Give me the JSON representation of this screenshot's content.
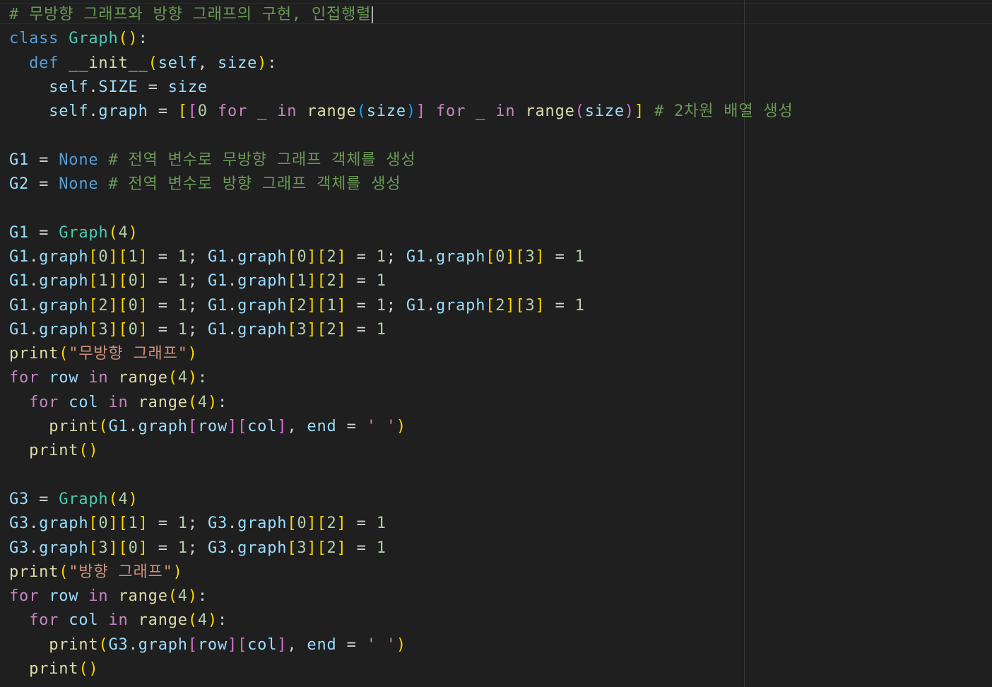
{
  "editor": {
    "lines": [
      [
        [
          "comment",
          "# 무방향 그래프와 방향 그래프의 구현, 인접행렬"
        ]
      ],
      [
        [
          "kw-blue",
          "class"
        ],
        [
          "plain",
          " "
        ],
        [
          "cls",
          "Graph"
        ],
        [
          "b1",
          "()"
        ],
        [
          "plain",
          ":"
        ]
      ],
      [
        [
          "plain",
          "  "
        ],
        [
          "kw-blue",
          "def"
        ],
        [
          "plain",
          " "
        ],
        [
          "func",
          "__init__"
        ],
        [
          "b1",
          "("
        ],
        [
          "var",
          "self"
        ],
        [
          "plain",
          ", "
        ],
        [
          "var",
          "size"
        ],
        [
          "b1",
          ")"
        ],
        [
          "plain",
          ":"
        ]
      ],
      [
        [
          "plain",
          "    "
        ],
        [
          "var",
          "self"
        ],
        [
          "plain",
          "."
        ],
        [
          "var",
          "SIZE"
        ],
        [
          "plain",
          " = "
        ],
        [
          "var",
          "size"
        ]
      ],
      [
        [
          "plain",
          "    "
        ],
        [
          "var",
          "self"
        ],
        [
          "plain",
          "."
        ],
        [
          "var",
          "graph"
        ],
        [
          "plain",
          " = "
        ],
        [
          "b1",
          "["
        ],
        [
          "b2",
          "["
        ],
        [
          "num",
          "0"
        ],
        [
          "plain",
          " "
        ],
        [
          "kw-ctrl",
          "for"
        ],
        [
          "plain",
          " "
        ],
        [
          "var",
          "_"
        ],
        [
          "plain",
          " "
        ],
        [
          "kw-ctrl",
          "in"
        ],
        [
          "plain",
          " "
        ],
        [
          "func",
          "range"
        ],
        [
          "b3",
          "("
        ],
        [
          "var",
          "size"
        ],
        [
          "b3",
          ")"
        ],
        [
          "b2",
          "]"
        ],
        [
          "plain",
          " "
        ],
        [
          "kw-ctrl",
          "for"
        ],
        [
          "plain",
          " "
        ],
        [
          "var",
          "_"
        ],
        [
          "plain",
          " "
        ],
        [
          "kw-ctrl",
          "in"
        ],
        [
          "plain",
          " "
        ],
        [
          "func",
          "range"
        ],
        [
          "b2",
          "("
        ],
        [
          "var",
          "size"
        ],
        [
          "b2",
          ")"
        ],
        [
          "b1",
          "]"
        ],
        [
          "plain",
          " "
        ],
        [
          "comment",
          "# 2차원 배열 생성"
        ]
      ],
      [
        [
          "plain",
          ""
        ]
      ],
      [
        [
          "var",
          "G1"
        ],
        [
          "plain",
          " = "
        ],
        [
          "kw-blue",
          "None"
        ],
        [
          "plain",
          " "
        ],
        [
          "comment",
          "# 전역 변수로 무방향 그래프 객체를 생성"
        ]
      ],
      [
        [
          "var",
          "G2"
        ],
        [
          "plain",
          " = "
        ],
        [
          "kw-blue",
          "None"
        ],
        [
          "plain",
          " "
        ],
        [
          "comment",
          "# 전역 변수로 방향 그래프 객체를 생성"
        ]
      ],
      [
        [
          "plain",
          ""
        ]
      ],
      [
        [
          "var",
          "G1"
        ],
        [
          "plain",
          " = "
        ],
        [
          "cls",
          "Graph"
        ],
        [
          "b1",
          "("
        ],
        [
          "num",
          "4"
        ],
        [
          "b1",
          ")"
        ]
      ],
      [
        [
          "var",
          "G1"
        ],
        [
          "plain",
          "."
        ],
        [
          "var",
          "graph"
        ],
        [
          "b1",
          "["
        ],
        [
          "num",
          "0"
        ],
        [
          "b1",
          "]"
        ],
        [
          "b1",
          "["
        ],
        [
          "num",
          "1"
        ],
        [
          "b1",
          "]"
        ],
        [
          "plain",
          " = "
        ],
        [
          "num",
          "1"
        ],
        [
          "plain",
          "; "
        ],
        [
          "var",
          "G1"
        ],
        [
          "plain",
          "."
        ],
        [
          "var",
          "graph"
        ],
        [
          "b1",
          "["
        ],
        [
          "num",
          "0"
        ],
        [
          "b1",
          "]"
        ],
        [
          "b1",
          "["
        ],
        [
          "num",
          "2"
        ],
        [
          "b1",
          "]"
        ],
        [
          "plain",
          " = "
        ],
        [
          "num",
          "1"
        ],
        [
          "plain",
          "; "
        ],
        [
          "var",
          "G1"
        ],
        [
          "plain",
          "."
        ],
        [
          "var",
          "graph"
        ],
        [
          "b1",
          "["
        ],
        [
          "num",
          "0"
        ],
        [
          "b1",
          "]"
        ],
        [
          "b1",
          "["
        ],
        [
          "num",
          "3"
        ],
        [
          "b1",
          "]"
        ],
        [
          "plain",
          " = "
        ],
        [
          "num",
          "1"
        ]
      ],
      [
        [
          "var",
          "G1"
        ],
        [
          "plain",
          "."
        ],
        [
          "var",
          "graph"
        ],
        [
          "b1",
          "["
        ],
        [
          "num",
          "1"
        ],
        [
          "b1",
          "]"
        ],
        [
          "b1",
          "["
        ],
        [
          "num",
          "0"
        ],
        [
          "b1",
          "]"
        ],
        [
          "plain",
          " = "
        ],
        [
          "num",
          "1"
        ],
        [
          "plain",
          "; "
        ],
        [
          "var",
          "G1"
        ],
        [
          "plain",
          "."
        ],
        [
          "var",
          "graph"
        ],
        [
          "b1",
          "["
        ],
        [
          "num",
          "1"
        ],
        [
          "b1",
          "]"
        ],
        [
          "b1",
          "["
        ],
        [
          "num",
          "2"
        ],
        [
          "b1",
          "]"
        ],
        [
          "plain",
          " = "
        ],
        [
          "num",
          "1"
        ]
      ],
      [
        [
          "var",
          "G1"
        ],
        [
          "plain",
          "."
        ],
        [
          "var",
          "graph"
        ],
        [
          "b1",
          "["
        ],
        [
          "num",
          "2"
        ],
        [
          "b1",
          "]"
        ],
        [
          "b1",
          "["
        ],
        [
          "num",
          "0"
        ],
        [
          "b1",
          "]"
        ],
        [
          "plain",
          " = "
        ],
        [
          "num",
          "1"
        ],
        [
          "plain",
          "; "
        ],
        [
          "var",
          "G1"
        ],
        [
          "plain",
          "."
        ],
        [
          "var",
          "graph"
        ],
        [
          "b1",
          "["
        ],
        [
          "num",
          "2"
        ],
        [
          "b1",
          "]"
        ],
        [
          "b1",
          "["
        ],
        [
          "num",
          "1"
        ],
        [
          "b1",
          "]"
        ],
        [
          "plain",
          " = "
        ],
        [
          "num",
          "1"
        ],
        [
          "plain",
          "; "
        ],
        [
          "var",
          "G1"
        ],
        [
          "plain",
          "."
        ],
        [
          "var",
          "graph"
        ],
        [
          "b1",
          "["
        ],
        [
          "num",
          "2"
        ],
        [
          "b1",
          "]"
        ],
        [
          "b1",
          "["
        ],
        [
          "num",
          "3"
        ],
        [
          "b1",
          "]"
        ],
        [
          "plain",
          " = "
        ],
        [
          "num",
          "1"
        ]
      ],
      [
        [
          "var",
          "G1"
        ],
        [
          "plain",
          "."
        ],
        [
          "var",
          "graph"
        ],
        [
          "b1",
          "["
        ],
        [
          "num",
          "3"
        ],
        [
          "b1",
          "]"
        ],
        [
          "b1",
          "["
        ],
        [
          "num",
          "0"
        ],
        [
          "b1",
          "]"
        ],
        [
          "plain",
          " = "
        ],
        [
          "num",
          "1"
        ],
        [
          "plain",
          "; "
        ],
        [
          "var",
          "G1"
        ],
        [
          "plain",
          "."
        ],
        [
          "var",
          "graph"
        ],
        [
          "b1",
          "["
        ],
        [
          "num",
          "3"
        ],
        [
          "b1",
          "]"
        ],
        [
          "b1",
          "["
        ],
        [
          "num",
          "2"
        ],
        [
          "b1",
          "]"
        ],
        [
          "plain",
          " = "
        ],
        [
          "num",
          "1"
        ]
      ],
      [
        [
          "func",
          "print"
        ],
        [
          "b1",
          "("
        ],
        [
          "str",
          "\"무방향 그래프\""
        ],
        [
          "b1",
          ")"
        ]
      ],
      [
        [
          "kw-ctrl",
          "for"
        ],
        [
          "plain",
          " "
        ],
        [
          "var",
          "row"
        ],
        [
          "plain",
          " "
        ],
        [
          "kw-ctrl",
          "in"
        ],
        [
          "plain",
          " "
        ],
        [
          "func",
          "range"
        ],
        [
          "b1",
          "("
        ],
        [
          "num",
          "4"
        ],
        [
          "b1",
          ")"
        ],
        [
          "plain",
          ":"
        ]
      ],
      [
        [
          "plain",
          "  "
        ],
        [
          "kw-ctrl",
          "for"
        ],
        [
          "plain",
          " "
        ],
        [
          "var",
          "col"
        ],
        [
          "plain",
          " "
        ],
        [
          "kw-ctrl",
          "in"
        ],
        [
          "plain",
          " "
        ],
        [
          "func",
          "range"
        ],
        [
          "b1",
          "("
        ],
        [
          "num",
          "4"
        ],
        [
          "b1",
          ")"
        ],
        [
          "plain",
          ":"
        ]
      ],
      [
        [
          "plain",
          "    "
        ],
        [
          "func",
          "print"
        ],
        [
          "b1",
          "("
        ],
        [
          "var",
          "G1"
        ],
        [
          "plain",
          "."
        ],
        [
          "var",
          "graph"
        ],
        [
          "b2",
          "["
        ],
        [
          "var",
          "row"
        ],
        [
          "b2",
          "]"
        ],
        [
          "b2",
          "["
        ],
        [
          "var",
          "col"
        ],
        [
          "b2",
          "]"
        ],
        [
          "plain",
          ", "
        ],
        [
          "var",
          "end"
        ],
        [
          "plain",
          " = "
        ],
        [
          "str",
          "' '"
        ],
        [
          "b1",
          ")"
        ]
      ],
      [
        [
          "plain",
          "  "
        ],
        [
          "func",
          "print"
        ],
        [
          "b1",
          "()"
        ]
      ],
      [
        [
          "plain",
          ""
        ]
      ],
      [
        [
          "var",
          "G3"
        ],
        [
          "plain",
          " = "
        ],
        [
          "cls",
          "Graph"
        ],
        [
          "b1",
          "("
        ],
        [
          "num",
          "4"
        ],
        [
          "b1",
          ")"
        ]
      ],
      [
        [
          "var",
          "G3"
        ],
        [
          "plain",
          "."
        ],
        [
          "var",
          "graph"
        ],
        [
          "b1",
          "["
        ],
        [
          "num",
          "0"
        ],
        [
          "b1",
          "]"
        ],
        [
          "b1",
          "["
        ],
        [
          "num",
          "1"
        ],
        [
          "b1",
          "]"
        ],
        [
          "plain",
          " = "
        ],
        [
          "num",
          "1"
        ],
        [
          "plain",
          "; "
        ],
        [
          "var",
          "G3"
        ],
        [
          "plain",
          "."
        ],
        [
          "var",
          "graph"
        ],
        [
          "b1",
          "["
        ],
        [
          "num",
          "0"
        ],
        [
          "b1",
          "]"
        ],
        [
          "b1",
          "["
        ],
        [
          "num",
          "2"
        ],
        [
          "b1",
          "]"
        ],
        [
          "plain",
          " = "
        ],
        [
          "num",
          "1"
        ]
      ],
      [
        [
          "var",
          "G3"
        ],
        [
          "plain",
          "."
        ],
        [
          "var",
          "graph"
        ],
        [
          "b1",
          "["
        ],
        [
          "num",
          "3"
        ],
        [
          "b1",
          "]"
        ],
        [
          "b1",
          "["
        ],
        [
          "num",
          "0"
        ],
        [
          "b1",
          "]"
        ],
        [
          "plain",
          " = "
        ],
        [
          "num",
          "1"
        ],
        [
          "plain",
          "; "
        ],
        [
          "var",
          "G3"
        ],
        [
          "plain",
          "."
        ],
        [
          "var",
          "graph"
        ],
        [
          "b1",
          "["
        ],
        [
          "num",
          "3"
        ],
        [
          "b1",
          "]"
        ],
        [
          "b1",
          "["
        ],
        [
          "num",
          "2"
        ],
        [
          "b1",
          "]"
        ],
        [
          "plain",
          " = "
        ],
        [
          "num",
          "1"
        ]
      ],
      [
        [
          "func",
          "print"
        ],
        [
          "b1",
          "("
        ],
        [
          "str",
          "\"방향 그래프\""
        ],
        [
          "b1",
          ")"
        ]
      ],
      [
        [
          "kw-ctrl",
          "for"
        ],
        [
          "plain",
          " "
        ],
        [
          "var",
          "row"
        ],
        [
          "plain",
          " "
        ],
        [
          "kw-ctrl",
          "in"
        ],
        [
          "plain",
          " "
        ],
        [
          "func",
          "range"
        ],
        [
          "b1",
          "("
        ],
        [
          "num",
          "4"
        ],
        [
          "b1",
          ")"
        ],
        [
          "plain",
          ":"
        ]
      ],
      [
        [
          "plain",
          "  "
        ],
        [
          "kw-ctrl",
          "for"
        ],
        [
          "plain",
          " "
        ],
        [
          "var",
          "col"
        ],
        [
          "plain",
          " "
        ],
        [
          "kw-ctrl",
          "in"
        ],
        [
          "plain",
          " "
        ],
        [
          "func",
          "range"
        ],
        [
          "b1",
          "("
        ],
        [
          "num",
          "4"
        ],
        [
          "b1",
          ")"
        ],
        [
          "plain",
          ":"
        ]
      ],
      [
        [
          "plain",
          "    "
        ],
        [
          "func",
          "print"
        ],
        [
          "b1",
          "("
        ],
        [
          "var",
          "G3"
        ],
        [
          "plain",
          "."
        ],
        [
          "var",
          "graph"
        ],
        [
          "b2",
          "["
        ],
        [
          "var",
          "row"
        ],
        [
          "b2",
          "]"
        ],
        [
          "b2",
          "["
        ],
        [
          "var",
          "col"
        ],
        [
          "b2",
          "]"
        ],
        [
          "plain",
          ", "
        ],
        [
          "var",
          "end"
        ],
        [
          "plain",
          " = "
        ],
        [
          "str",
          "' '"
        ],
        [
          "b1",
          ")"
        ]
      ],
      [
        [
          "plain",
          "  "
        ],
        [
          "func",
          "print"
        ],
        [
          "b1",
          "()"
        ]
      ]
    ],
    "cursor_line": 1
  }
}
